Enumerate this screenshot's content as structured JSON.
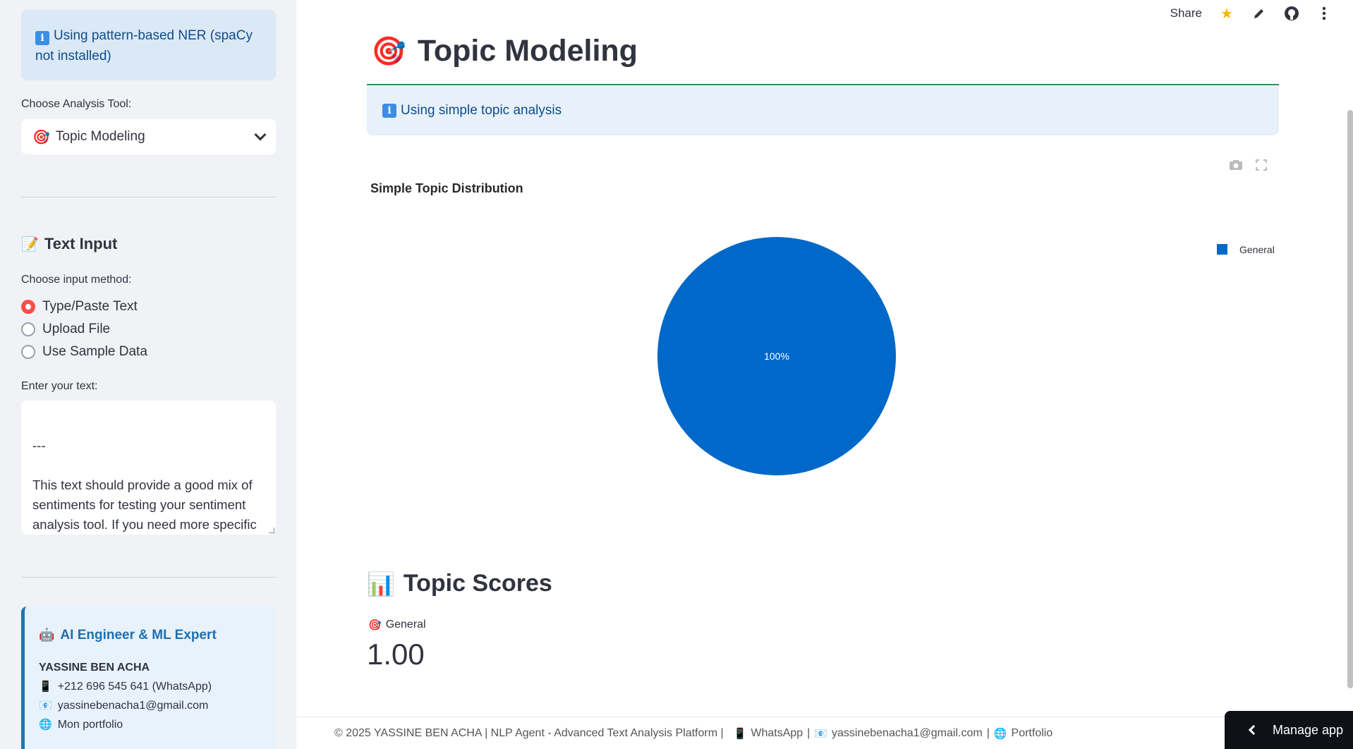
{
  "sidebar": {
    "info": "Using pattern-based NER (spaCy not installed)",
    "tool_label": "Choose Analysis Tool:",
    "tool_selected": "Topic Modeling",
    "text_input_heading": "Text Input",
    "method_label": "Choose input method:",
    "methods": [
      "Type/Paste Text",
      "Upload File",
      "Use Sample Data"
    ],
    "selected_method": "Type/Paste Text",
    "text_label": "Enter your text:",
    "text_value": "---\n\nThis text should provide a good mix of sentiments for testing your sentiment analysis tool. If you need more specific examples or a different tone, feel free to let me know!",
    "profile": {
      "title": "AI Engineer & ML Expert",
      "name": "YASSINE BEN ACHA",
      "phone": "+212 696 545 641 (WhatsApp)",
      "email": "yassinebenacha1@gmail.com",
      "portfolio": "Mon portfolio"
    }
  },
  "topbar": {
    "share": "Share"
  },
  "main": {
    "title": "Topic Modeling",
    "info": "Using simple topic analysis",
    "section_title": "Topic Scores",
    "metric_label": "General",
    "metric_value": "1.00"
  },
  "chart_data": {
    "type": "pie",
    "title": "Simple Topic Distribution",
    "categories": [
      "General"
    ],
    "values": [
      100
    ],
    "labels": [
      "100%"
    ],
    "colors": [
      "#0068c9"
    ],
    "legend": "top-right"
  },
  "footer": {
    "copyright": "© 2025 YASSINE BEN ACHA | NLP Agent - Advanced Text Analysis Platform |",
    "whatsapp": "WhatsApp",
    "email": "yassinebenacha1@gmail.com",
    "portfolio": "Portfolio"
  },
  "manage": {
    "label": "Manage app"
  }
}
